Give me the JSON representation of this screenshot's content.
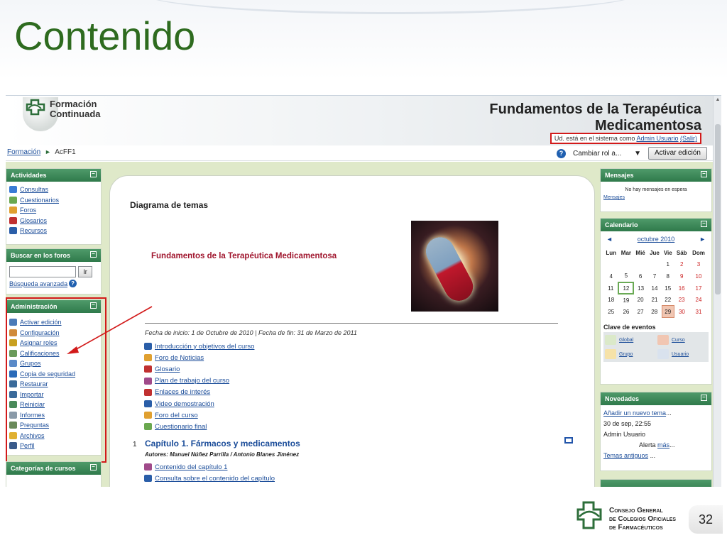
{
  "slide": {
    "title": "Contenido",
    "page_number": "32"
  },
  "header": {
    "logo_line1": "Formación",
    "logo_line2": "Continuada",
    "course_title_line1": "Fundamentos de la Terapéutica",
    "course_title_line2": "Medicamentosa",
    "login_prefix": "Ud. está en el sistema como",
    "login_user": "Admin Usuario",
    "logout": "(Salir)"
  },
  "navbar": {
    "crumb_home": "Formación",
    "crumb_sep": "►",
    "crumb_current": "AcFF1",
    "role_select": "Cambiar rol a...",
    "edit_button": "Activar edición"
  },
  "left": {
    "actividades": {
      "title": "Actividades",
      "items": [
        "Consultas",
        "Cuestionarios",
        "Foros",
        "Glosarios",
        "Recursos"
      ]
    },
    "buscar": {
      "title": "Buscar en los foros",
      "go_button": "Ir",
      "advanced": "Búsqueda avanzada"
    },
    "admin": {
      "title": "Administración",
      "items": [
        "Activar edición",
        "Configuración",
        "Asignar roles",
        "Calificaciones",
        "Grupos",
        "Copia de seguridad",
        "Restaurar",
        "Importar",
        "Reiniciar",
        "Informes",
        "Preguntas",
        "Archivos",
        "Perfil"
      ]
    },
    "categorias": {
      "title": "Categorías de cursos"
    }
  },
  "center": {
    "diagram_title": "Diagrama de temas",
    "course_title": "Fundamentos de la Terapéutica Medicamentosa",
    "dates": "Fecha de inicio: 1 de Octubre de 2010 | Fecha de fin: 31 de Marzo de 2011",
    "topics": [
      "Introducción y objetivos del curso",
      "Foro de Noticias",
      "Glosario",
      "Plan de trabajo del curso",
      "Enlaces de interés",
      "Video demostración",
      "Foro del curso",
      "Cuestionario final"
    ],
    "section1": {
      "number": "1",
      "title": "Capítulo 1. Fármacos y medicamentos",
      "authors": "Autores: Manuel Núñez Parrilla / Antonio Blanes Jiménez",
      "items": [
        "Contenido del capítulo 1",
        "Consulta sobre el contenido del capítulo"
      ]
    }
  },
  "right": {
    "mensajes": {
      "title": "Mensajes",
      "empty": "No hay mensajes en espera",
      "link": "Mensajes"
    },
    "calendario": {
      "title": "Calendario",
      "prev": "◄",
      "month": "octubre 2010",
      "next": "►",
      "weekdays": [
        "Lun",
        "Mar",
        "Mié",
        "Jue",
        "Vie",
        "Sáb",
        "Dom"
      ],
      "weeks": [
        [
          "",
          "",
          "",
          "",
          "1",
          "2",
          "3"
        ],
        [
          "4",
          "5",
          "6",
          "7",
          "8",
          "9",
          "10"
        ],
        [
          "11",
          "12",
          "13",
          "14",
          "15",
          "16",
          "17"
        ],
        [
          "18",
          "19",
          "20",
          "21",
          "22",
          "23",
          "24"
        ],
        [
          "25",
          "26",
          "27",
          "28",
          "29",
          "30",
          "31"
        ]
      ],
      "today": "12",
      "event_day": "29",
      "legend_title": "Clave de eventos",
      "legend": [
        "Global",
        "Curso",
        "Grupo",
        "Usuario"
      ]
    },
    "novedades": {
      "title": "Novedades",
      "add": "Añadir un nuevo tema",
      "add_suffix": "...",
      "date": "30 de sep, 22:55",
      "user": "Admin Usuario",
      "alert": "Alerta",
      "more": "más",
      "more_suffix": "...",
      "old": "Temas antiguos",
      "old_suffix": "..."
    }
  },
  "footer": {
    "org_line1": "Consejo General",
    "org_line2": "de Colegios Oficiales",
    "org_line3": "de Farmacéuticos"
  },
  "colors": {
    "title_green": "#2e6b1f",
    "block_green": "#2f7a4b",
    "highlight_red": "#d21a1a",
    "link_blue": "#1a4c99",
    "course_red": "#a0162e"
  }
}
